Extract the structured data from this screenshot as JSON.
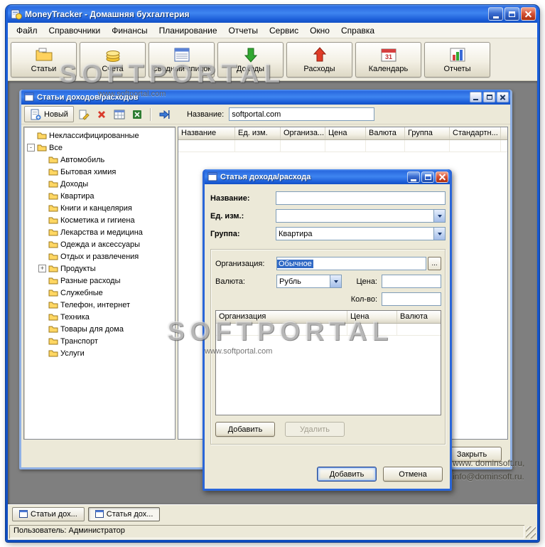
{
  "window": {
    "title": "MoneyTracker - Домашняя бухгалтерия"
  },
  "menu": {
    "items": [
      "Файл",
      "Справочники",
      "Финансы",
      "Планирование",
      "Отчеты",
      "Сервис",
      "Окно",
      "Справка"
    ]
  },
  "toolbar": {
    "buttons": [
      "Статьи",
      "Счета",
      "Сводный список",
      "Доходы",
      "Расходы",
      "Календарь",
      "Отчеты"
    ]
  },
  "icons": {
    "titlebar": [
      "minimize-icon",
      "maximize-icon",
      "close-icon"
    ],
    "toolbar": [
      "folder-icon",
      "coins-icon",
      "summary-list-icon",
      "income-arrow-icon",
      "expense-arrow-icon",
      "calendar-icon",
      "report-chart-icon"
    ],
    "child_toolbar": [
      "new-document-icon",
      "edit-icon",
      "delete-icon",
      "table-icon",
      "excel-icon",
      "transfer-arrow-icon"
    ],
    "tree": "folder-icon",
    "tabs": "form-icon"
  },
  "watermark": {
    "title": "SOFTPORTAL",
    "subtitle": "www.softportal.com"
  },
  "child_window": {
    "title": "Статьи доходов/расходов",
    "toolbar": {
      "new_button": "Новый",
      "name_label": "Название:",
      "name_value": "softportal.com"
    },
    "tree": {
      "items": [
        {
          "label": "Неклассифицированные",
          "indent": 0,
          "sign": ""
        },
        {
          "label": "Все",
          "indent": 0,
          "sign": "-"
        },
        {
          "label": "Автомобиль",
          "indent": 1,
          "sign": ""
        },
        {
          "label": "Бытовая химия",
          "indent": 1,
          "sign": ""
        },
        {
          "label": "Доходы",
          "indent": 1,
          "sign": ""
        },
        {
          "label": "Квартира",
          "indent": 1,
          "sign": ""
        },
        {
          "label": "Книги и канцелярия",
          "indent": 1,
          "sign": ""
        },
        {
          "label": "Косметика и гигиена",
          "indent": 1,
          "sign": ""
        },
        {
          "label": "Лекарства и медицина",
          "indent": 1,
          "sign": ""
        },
        {
          "label": "Одежда и аксессуары",
          "indent": 1,
          "sign": ""
        },
        {
          "label": "Отдых и развлечения",
          "indent": 1,
          "sign": ""
        },
        {
          "label": "Продукты",
          "indent": 1,
          "sign": "+"
        },
        {
          "label": "Разные расходы",
          "indent": 1,
          "sign": ""
        },
        {
          "label": "Служебные",
          "indent": 1,
          "sign": ""
        },
        {
          "label": "Телефон, интернет",
          "indent": 1,
          "sign": ""
        },
        {
          "label": "Техника",
          "indent": 1,
          "sign": ""
        },
        {
          "label": "Товары для дома",
          "indent": 1,
          "sign": ""
        },
        {
          "label": "Транспорт",
          "indent": 1,
          "sign": ""
        },
        {
          "label": "Услуги",
          "indent": 1,
          "sign": ""
        }
      ]
    },
    "table": {
      "columns": [
        {
          "label": "Название",
          "width": 80
        },
        {
          "label": "Ед. изм.",
          "width": 64
        },
        {
          "label": "Организа...",
          "width": 63
        },
        {
          "label": "Цена",
          "width": 57
        },
        {
          "label": "Валюта",
          "width": 55
        },
        {
          "label": "Группа",
          "width": 63
        },
        {
          "label": "Стандартн...",
          "width": 72
        }
      ]
    },
    "close_button": "Закрыть"
  },
  "dialog": {
    "title": "Статья дохода/расхода",
    "name_label": "Название:",
    "unit_label": "Ед. изм.:",
    "group_label": "Группа:",
    "group_value": "Квартира",
    "org_label": "Организация:",
    "org_value": "Обычное",
    "org_browse": "...",
    "currency_label": "Валюта:",
    "currency_value": "Рубль",
    "price_label": "Цена:",
    "qty_label": "Кол-во:",
    "table": {
      "columns": [
        {
          "label": "Организация",
          "width": 185
        },
        {
          "label": "Цена",
          "width": 70
        },
        {
          "label": "Валюта",
          "width": 64
        }
      ]
    },
    "add_row_button": "Добавить",
    "delete_row_button": "Удалить",
    "submit_button": "Добавить",
    "cancel_button": "Отмена"
  },
  "vendor_note": {
    "line1": "www. dominsoft.ru,",
    "line2": "info@dominsoft.ru."
  },
  "taskbar": {
    "tabs": [
      {
        "label": "Статьи дох..."
      },
      {
        "label": "Статья дох..."
      }
    ]
  },
  "statusbar": {
    "text": "Пользователь: Администратор"
  }
}
